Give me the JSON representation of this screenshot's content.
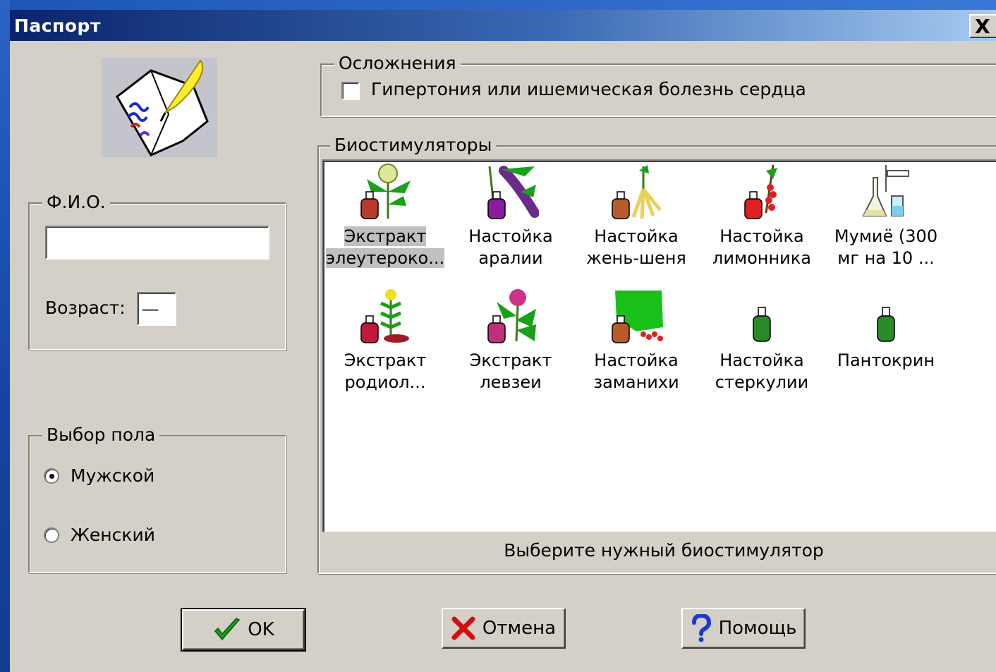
{
  "window": {
    "title": "Паспорт",
    "close_glyph": "X"
  },
  "complications": {
    "legend": "Осложнения",
    "checkbox_label": "Гипертония или ишемическая болезнь сердца",
    "checked": false
  },
  "fio": {
    "legend": "Ф.И.О.",
    "name_value": "",
    "age_label": "Возраст:",
    "age_value": "__"
  },
  "gender": {
    "legend": "Выбор пола",
    "options": [
      {
        "label": "Мужской",
        "selected": true
      },
      {
        "label": "Женский",
        "selected": false
      }
    ]
  },
  "biostimulators": {
    "legend": "Биостимуляторы",
    "items": [
      {
        "line1": "Экстракт",
        "line2": "элеутероко...",
        "icon": "eleutherococcus-extract-icon",
        "selected": true
      },
      {
        "line1": "Настойка",
        "line2": "аралии",
        "icon": "aralia-tincture-icon",
        "selected": false
      },
      {
        "line1": "Настойка",
        "line2": "жень-шеня",
        "icon": "ginseng-tincture-icon",
        "selected": false
      },
      {
        "line1": "Настойка",
        "line2": "лимонника",
        "icon": "schisandra-tincture-icon",
        "selected": false
      },
      {
        "line1": "Мумиё (300",
        "line2": "мг на 10 ...",
        "icon": "mumie-lab-icon",
        "selected": false
      },
      {
        "line1": "Экстракт",
        "line2": "родиол...",
        "icon": "rhodiola-extract-icon",
        "selected": false
      },
      {
        "line1": "Экстракт",
        "line2": "левзеи",
        "icon": "leuzea-extract-icon",
        "selected": false
      },
      {
        "line1": "Настойка",
        "line2": "заманихи",
        "icon": "oplopanax-tincture-icon",
        "selected": false
      },
      {
        "line1": "Настойка",
        "line2": "стеркулии",
        "icon": "sterculia-tincture-icon",
        "selected": false
      },
      {
        "line1": "Пантокрин",
        "line2": "",
        "icon": "pantocrine-bottle-icon",
        "selected": false
      }
    ],
    "hint": "Выберите нужный биостимулятор"
  },
  "buttons": {
    "ok": {
      "label": "OK",
      "icon": "checkmark-icon"
    },
    "cancel": {
      "label": "Отмена",
      "icon": "red-x-icon"
    },
    "help": {
      "label": "Помощь",
      "icon": "question-icon"
    }
  },
  "colors": {
    "title_start": "#0a246a",
    "title_end": "#a6caf0",
    "face": "#d4d0c8",
    "ok_green": "#1a9a1a",
    "cancel_red": "#d01010",
    "help_blue": "#1a3ad0"
  }
}
